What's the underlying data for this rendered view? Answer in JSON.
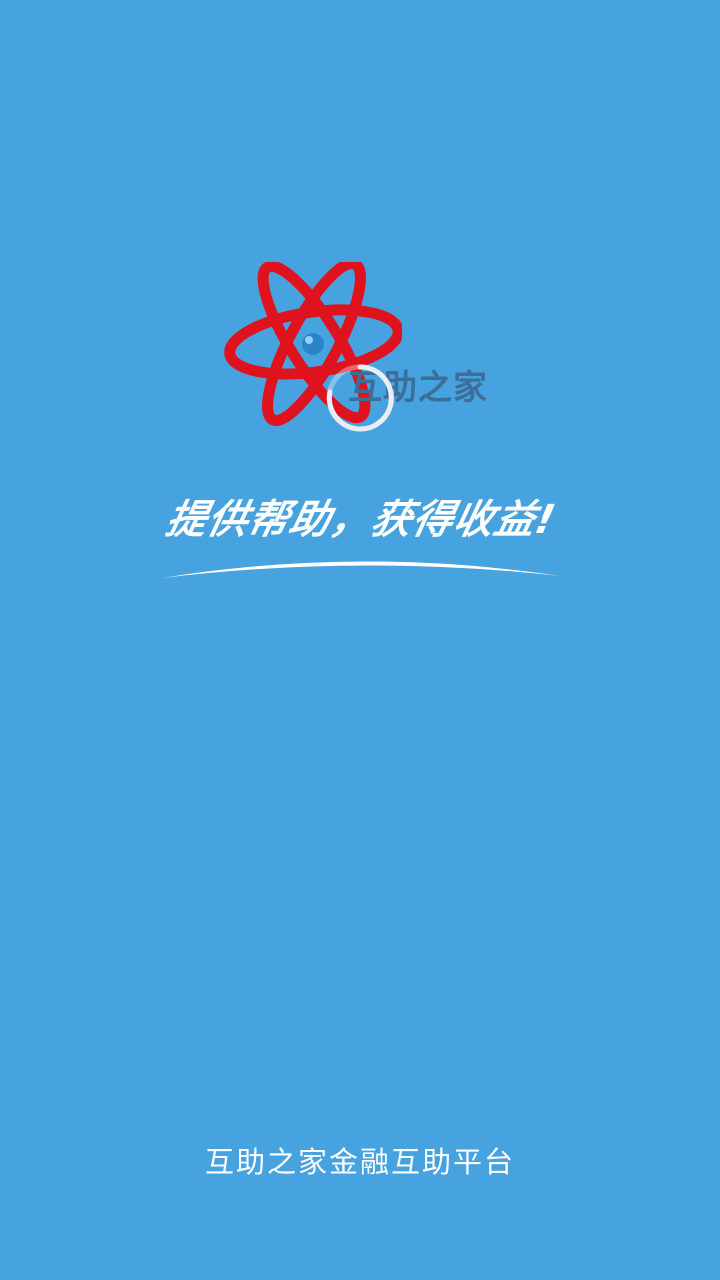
{
  "splash": {
    "brand_name": "互助之家",
    "slogan": "提供帮助，获得收益!",
    "footer_text": "互助之家金融互助平台",
    "logo_icon": "atom-logo-icon",
    "loading_icon": "loading-spinner-icon"
  },
  "colors": {
    "background": "#47a2e0",
    "logo_red": "#e0121d",
    "brand_text": "#3c6f98",
    "text": "#ffffff"
  }
}
